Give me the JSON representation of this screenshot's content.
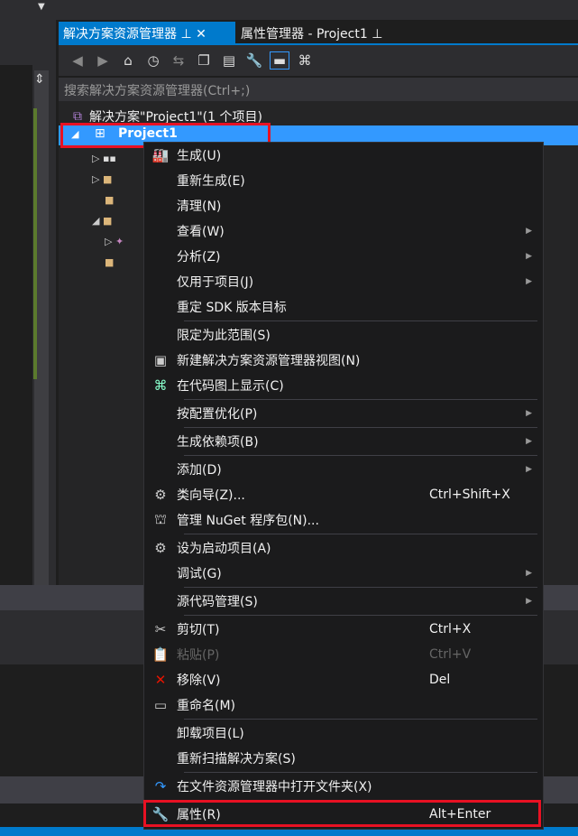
{
  "tabs": [
    {
      "label": "解决方案资源管理器",
      "active": true
    },
    {
      "label": "属性管理器 - Project1",
      "active": false
    }
  ],
  "search": {
    "placeholder": "搜索解决方案资源管理器(Ctrl+;)"
  },
  "tree": {
    "solution": "解决方案\"Project1\"(1 个项目)",
    "project": "Project1"
  },
  "menu": [
    {
      "label": "生成(U)",
      "icon": "build"
    },
    {
      "label": "重新生成(E)"
    },
    {
      "label": "清理(N)"
    },
    {
      "label": "查看(W)",
      "submenu": true
    },
    {
      "label": "分析(Z)",
      "submenu": true
    },
    {
      "label": "仅用于项目(J)",
      "submenu": true
    },
    {
      "label": "重定 SDK 版本目标",
      "sep_after": true
    },
    {
      "label": "限定为此范围(S)"
    },
    {
      "label": "新建解决方案资源管理器视图(N)",
      "icon": "new-view"
    },
    {
      "label": "在代码图上显示(C)",
      "icon": "code-map",
      "sep_after": true
    },
    {
      "label": "按配置优化(P)",
      "submenu": true,
      "sep_after": true
    },
    {
      "label": "生成依赖项(B)",
      "submenu": true,
      "sep_after": true
    },
    {
      "label": "添加(D)",
      "submenu": true
    },
    {
      "label": "类向导(Z)...",
      "icon": "class-wizard",
      "shortcut": "Ctrl+Shift+X"
    },
    {
      "label": "管理 NuGet 程序包(N)...",
      "icon": "nuget",
      "sep_after": true
    },
    {
      "label": "设为启动项目(A)",
      "icon": "gear"
    },
    {
      "label": "调试(G)",
      "submenu": true,
      "sep_after": true
    },
    {
      "label": "源代码管理(S)",
      "submenu": true,
      "sep_after": true
    },
    {
      "label": "剪切(T)",
      "icon": "scissors",
      "shortcut": "Ctrl+X"
    },
    {
      "label": "粘贴(P)",
      "icon": "paste",
      "shortcut": "Ctrl+V",
      "disabled": true
    },
    {
      "label": "移除(V)",
      "icon": "remove",
      "shortcut": "Del"
    },
    {
      "label": "重命名(M)",
      "icon": "rename",
      "sep_after": true
    },
    {
      "label": "卸载项目(L)"
    },
    {
      "label": "重新扫描解决方案(S)",
      "sep_after": true
    },
    {
      "label": "在文件资源管理器中打开文件夹(X)",
      "icon": "open-folder",
      "sep_after": true
    },
    {
      "label": "属性(R)",
      "icon": "wrench",
      "shortcut": "Alt+Enter"
    }
  ],
  "colors": {
    "accent": "#007acc",
    "selection": "#3399ff",
    "highlight_box": "#e81123"
  }
}
